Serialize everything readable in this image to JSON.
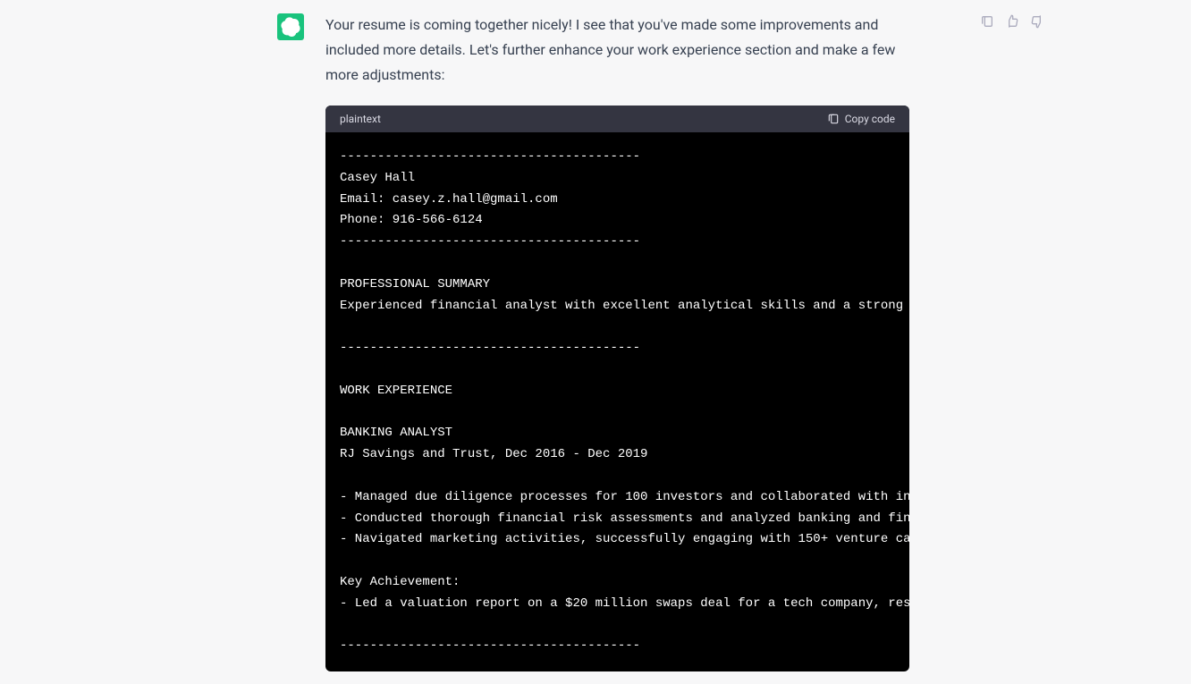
{
  "message": {
    "text": "Your resume is coming together nicely! I see that you've made some improvements and included more details. Let's further enhance your work experience section and make a few more adjustments:"
  },
  "codeBlock": {
    "language": "plaintext",
    "copyLabel": "Copy code",
    "content": "----------------------------------------\nCasey Hall\nEmail: casey.z.hall@gmail.com\nPhone: 916-566-6124\n----------------------------------------\n\nPROFESSIONAL SUMMARY\nExperienced financial analyst with excellent analytical skills and a strong \n\n----------------------------------------\n\nWORK EXPERIENCE\n\nBANKING ANALYST\nRJ Savings and Trust, Dec 2016 - Dec 2019\n\n- Managed due diligence processes for 100 investors and collaborated with in\n- Conducted thorough financial risk assessments and analyzed banking and fin\n- Navigated marketing activities, successfully engaging with 150+ venture ca\n\nKey Achievement:\n- Led a valuation report on a $20 million swaps deal for a tech company, res\n\n----------------------------------------"
  }
}
